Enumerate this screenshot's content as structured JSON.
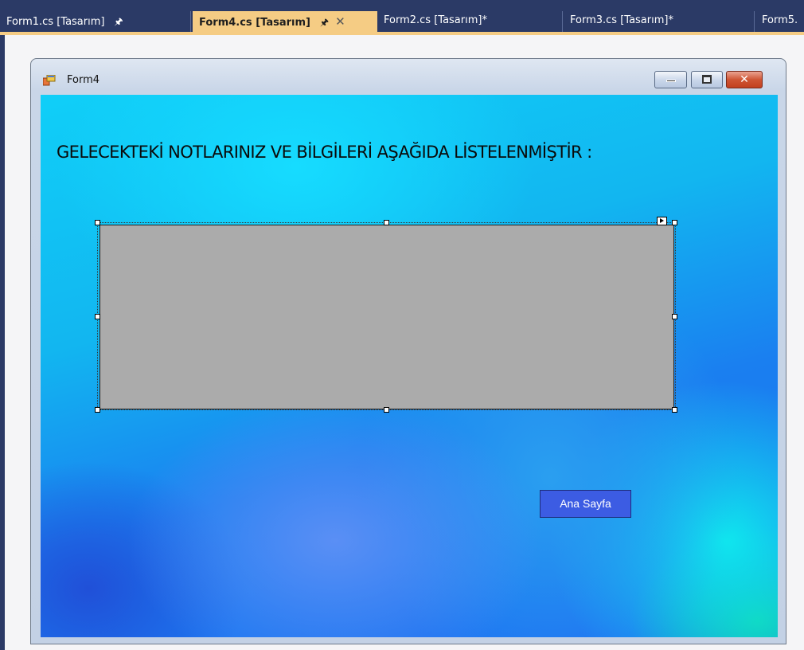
{
  "tabs": [
    {
      "label": "Form1.cs [Tasarım]",
      "pinned": true,
      "active": false
    },
    {
      "label": "Form4.cs [Tasarım]",
      "pinned": true,
      "active": true
    },
    {
      "label": "Form2.cs [Tasarım]*",
      "pinned": false,
      "active": false
    },
    {
      "label": "Form3.cs [Tasarım]*",
      "pinned": false,
      "active": false
    },
    {
      "label": "Form5.",
      "pinned": false,
      "active": false
    }
  ],
  "tab_icons": {
    "pin": "pin-icon",
    "close": "close-icon"
  },
  "form": {
    "title": "Form4",
    "icon": "form-icon",
    "caption_buttons": [
      "minimize-icon",
      "maximize-icon",
      "close-icon"
    ],
    "heading": "GELECEKTEKİ NOTLARINIZ VE BİLGİLERİ AŞAĞIDA LİSTELENMİŞTİR :",
    "button_label": "Ana Sayfa"
  },
  "colors": {
    "tabbar": "#2b3a66",
    "active_tab": "#f5cc84",
    "grid": "#ababab",
    "button": "#3c5ce3"
  }
}
